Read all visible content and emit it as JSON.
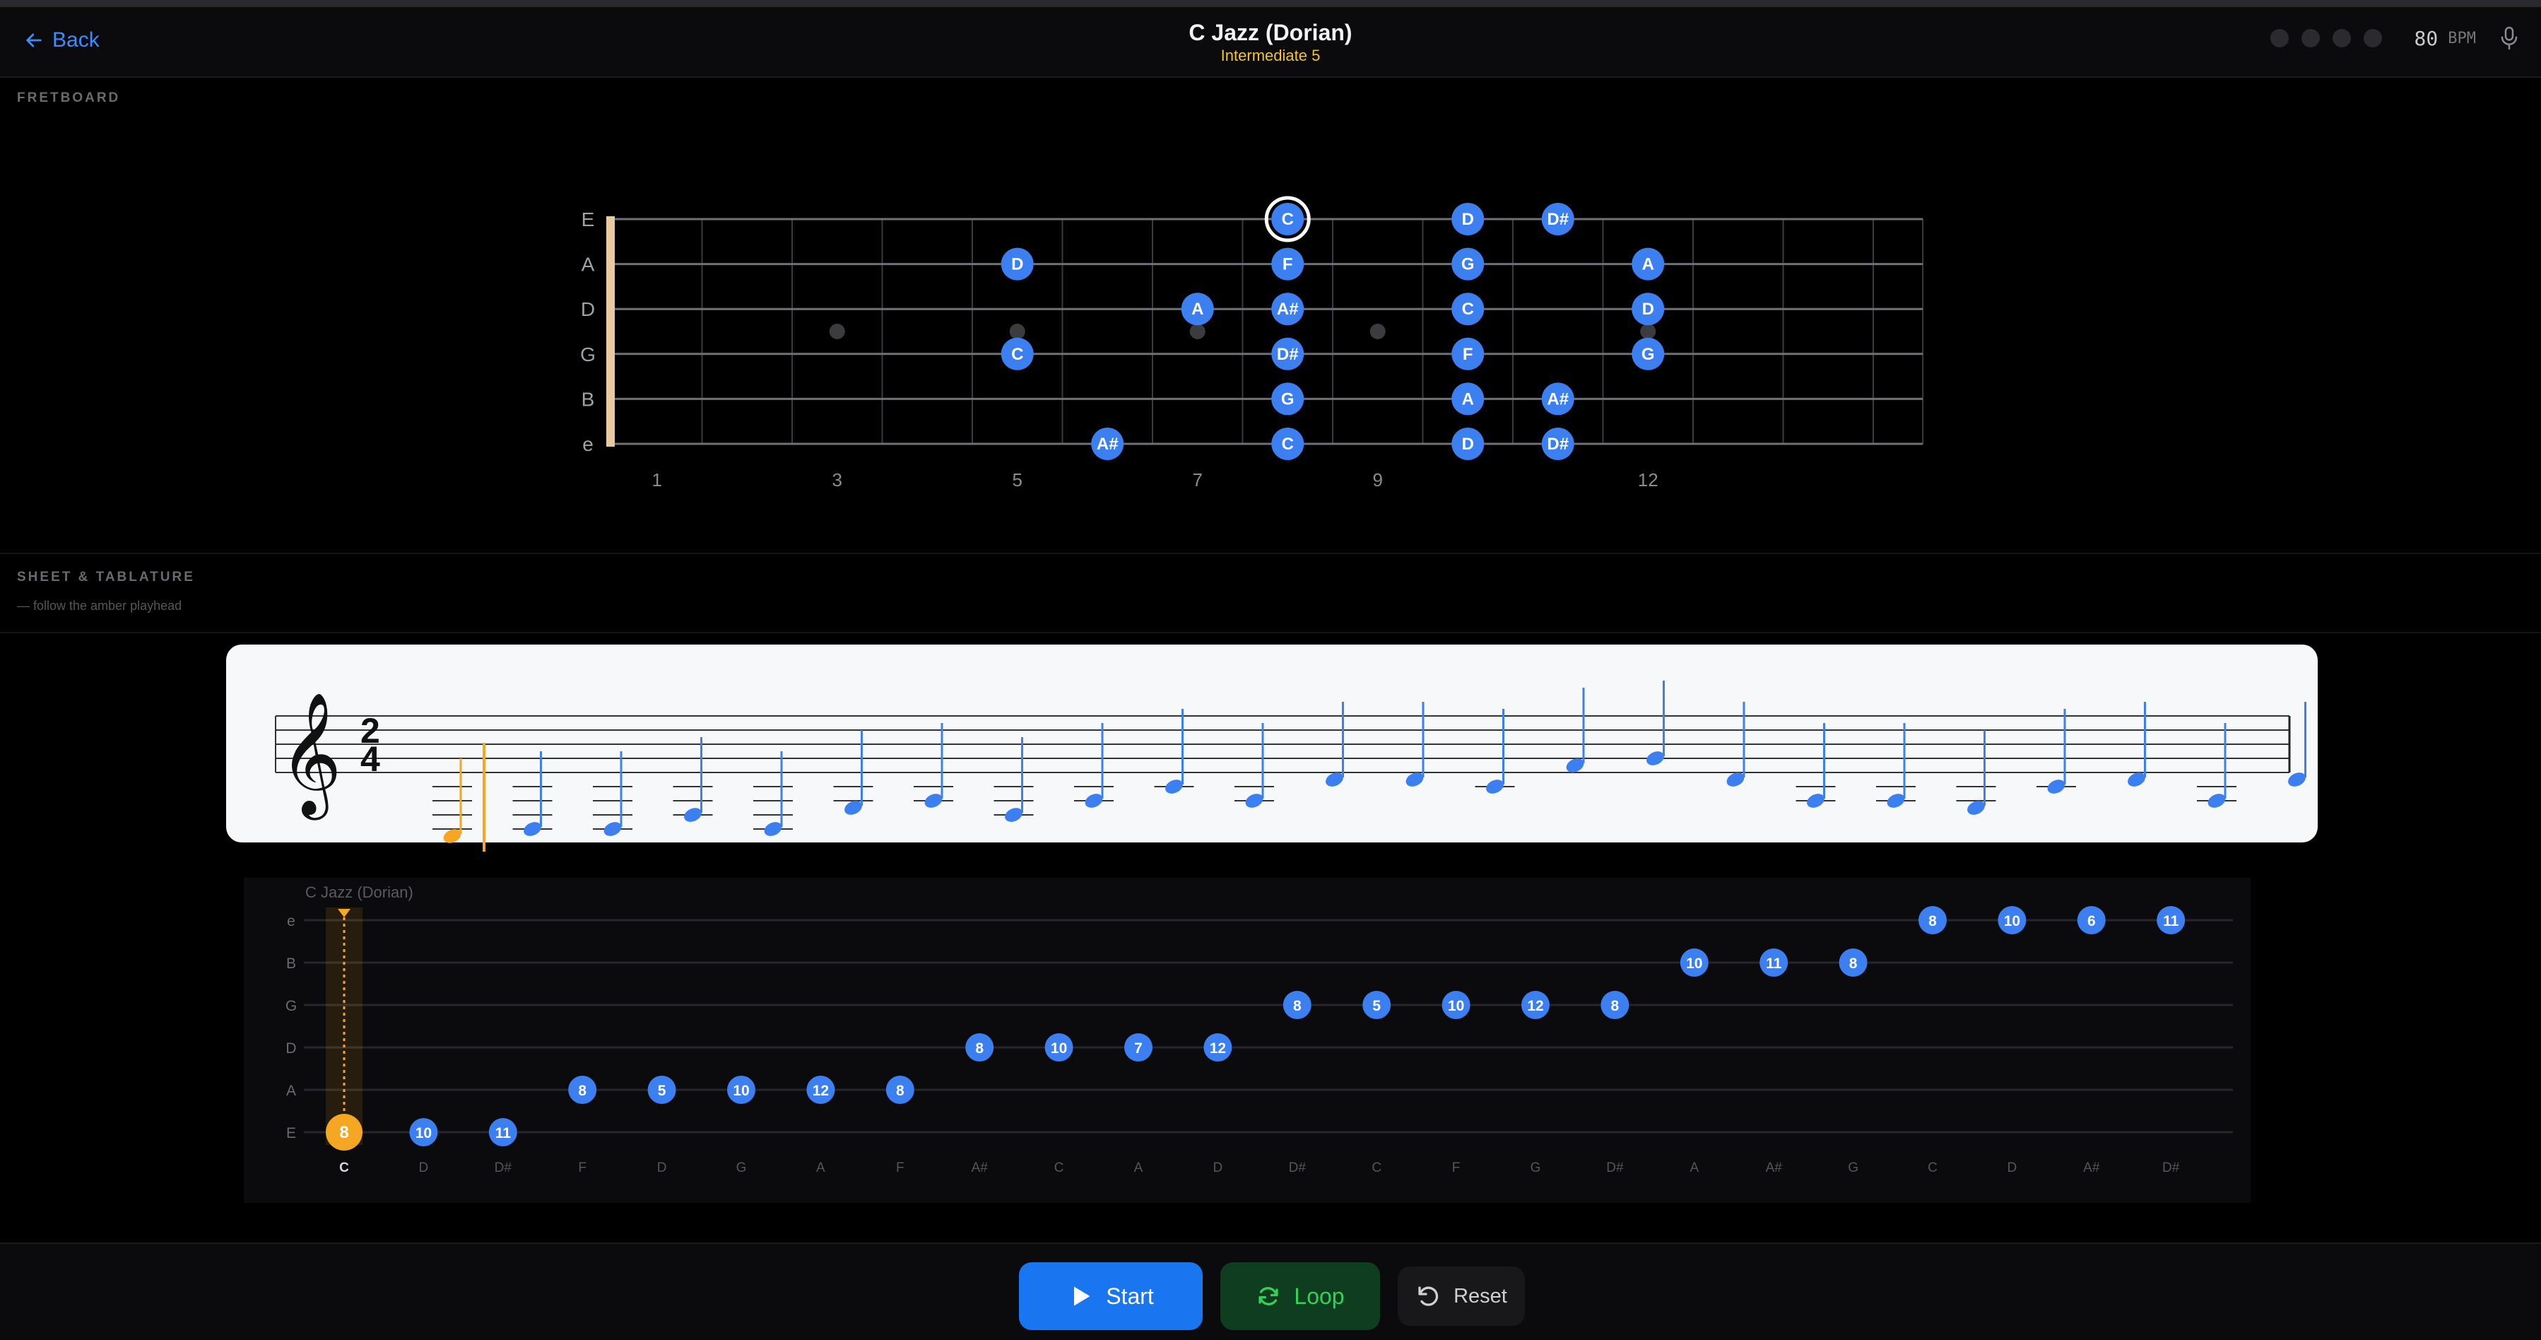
{
  "header": {
    "back_label": "Back",
    "title": "C Jazz (Dorian)",
    "subtitle": "Intermediate 5",
    "bpm_value": "80",
    "bpm_unit": "BPM"
  },
  "fretboard": {
    "section_label": "FRETBOARD",
    "strings": [
      "E",
      "A",
      "D",
      "G",
      "B",
      "e"
    ],
    "fret_markers": [
      "1",
      "3",
      "5",
      "7",
      "9",
      "12"
    ],
    "notes": [
      {
        "s": 0,
        "f": 8,
        "n": "C",
        "active": true
      },
      {
        "s": 0,
        "f": 10,
        "n": "D"
      },
      {
        "s": 0,
        "f": 11,
        "n": "D#"
      },
      {
        "s": 1,
        "f": 5,
        "n": "D"
      },
      {
        "s": 1,
        "f": 8,
        "n": "F"
      },
      {
        "s": 1,
        "f": 10,
        "n": "G"
      },
      {
        "s": 1,
        "f": 12,
        "n": "A"
      },
      {
        "s": 2,
        "f": 7,
        "n": "A"
      },
      {
        "s": 2,
        "f": 8,
        "n": "A#"
      },
      {
        "s": 2,
        "f": 10,
        "n": "C"
      },
      {
        "s": 2,
        "f": 12,
        "n": "D"
      },
      {
        "s": 3,
        "f": 5,
        "n": "C"
      },
      {
        "s": 3,
        "f": 8,
        "n": "D#"
      },
      {
        "s": 3,
        "f": 10,
        "n": "F"
      },
      {
        "s": 3,
        "f": 12,
        "n": "G"
      },
      {
        "s": 4,
        "f": 8,
        "n": "G"
      },
      {
        "s": 4,
        "f": 10,
        "n": "A"
      },
      {
        "s": 4,
        "f": 11,
        "n": "A#"
      },
      {
        "s": 5,
        "f": 6,
        "n": "A#"
      },
      {
        "s": 5,
        "f": 8,
        "n": "C"
      },
      {
        "s": 5,
        "f": 10,
        "n": "D"
      },
      {
        "s": 5,
        "f": 11,
        "n": "D#"
      }
    ]
  },
  "sheet": {
    "section_label": "SHEET & TABLATURE",
    "hint": "— follow the amber playhead",
    "time_signature": {
      "top": "2",
      "bottom": "4"
    }
  },
  "tab": {
    "caption": "C Jazz (Dorian)",
    "strings": [
      "e",
      "B",
      "G",
      "D",
      "A",
      "E"
    ],
    "notes": [
      {
        "name": "C",
        "string": "E",
        "fret": "8",
        "active": true
      },
      {
        "name": "D",
        "string": "E",
        "fret": "10"
      },
      {
        "name": "D#",
        "string": "E",
        "fret": "11"
      },
      {
        "name": "F",
        "string": "A",
        "fret": "8"
      },
      {
        "name": "D",
        "string": "A",
        "fret": "5"
      },
      {
        "name": "G",
        "string": "A",
        "fret": "10"
      },
      {
        "name": "A",
        "string": "A",
        "fret": "12"
      },
      {
        "name": "F",
        "string": "A",
        "fret": "8"
      },
      {
        "name": "A#",
        "string": "D",
        "fret": "8"
      },
      {
        "name": "C",
        "string": "D",
        "fret": "10"
      },
      {
        "name": "A",
        "string": "D",
        "fret": "7"
      },
      {
        "name": "D",
        "string": "D",
        "fret": "12"
      },
      {
        "name": "D#",
        "string": "G",
        "fret": "8"
      },
      {
        "name": "C",
        "string": "G",
        "fret": "5"
      },
      {
        "name": "F",
        "string": "G",
        "fret": "10"
      },
      {
        "name": "G",
        "string": "G",
        "fret": "12"
      },
      {
        "name": "D#",
        "string": "G",
        "fret": "8"
      },
      {
        "name": "A",
        "string": "B",
        "fret": "10"
      },
      {
        "name": "A#",
        "string": "B",
        "fret": "11"
      },
      {
        "name": "G",
        "string": "B",
        "fret": "8"
      },
      {
        "name": "C",
        "string": "e",
        "fret": "8"
      },
      {
        "name": "D",
        "string": "e",
        "fret": "10"
      },
      {
        "name": "A#",
        "string": "e",
        "fret": "6"
      },
      {
        "name": "D#",
        "string": "e",
        "fret": "11"
      }
    ]
  },
  "controls": {
    "start_label": "Start",
    "loop_label": "Loop",
    "reset_label": "Reset"
  },
  "colors": {
    "accent": "#3b7ff0",
    "playhead": "#f5a623",
    "loop": "#34d058",
    "subtitle": "#f5c518"
  }
}
